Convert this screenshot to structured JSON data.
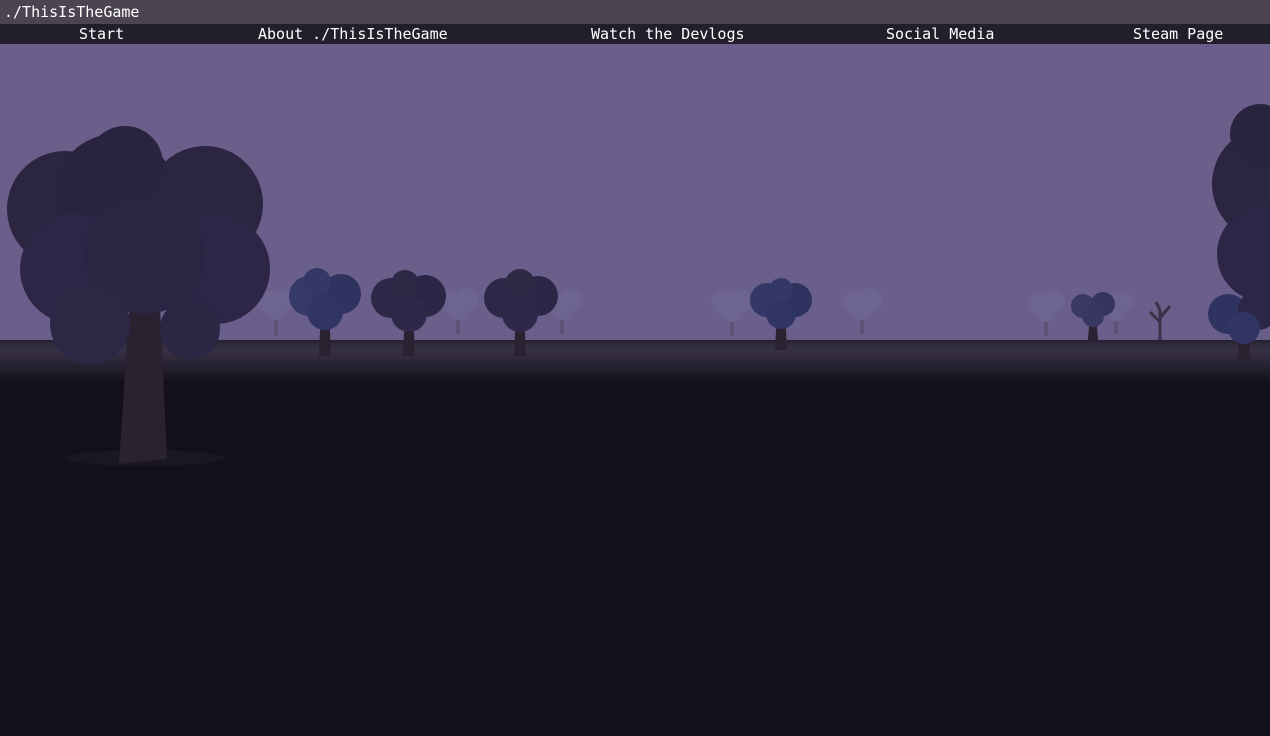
{
  "window": {
    "title": "./ThisIsTheGame"
  },
  "nav": {
    "items": [
      {
        "label": "Start"
      },
      {
        "label": "About ./ThisIsTheGame"
      },
      {
        "label": "Watch the Devlogs"
      },
      {
        "label": "Social Media"
      },
      {
        "label": "Steam Page"
      }
    ]
  },
  "colors": {
    "title_bar": "#4b4452",
    "nav_bar": "#221f2b",
    "sky": "#6a5f8a",
    "ground": "#121018",
    "foliage_near": "#2c2540",
    "foliage_mid": "#303055",
    "foliage_far": "#5e5578",
    "trunk": "#2a2230"
  },
  "scene": {
    "objects": [
      {
        "name": "large-tree-icon"
      },
      {
        "name": "tree-icon"
      },
      {
        "name": "tree-icon"
      },
      {
        "name": "tree-icon"
      },
      {
        "name": "tree-icon"
      },
      {
        "name": "tree-icon"
      },
      {
        "name": "distant-tree-icon"
      },
      {
        "name": "dead-tree-icon"
      },
      {
        "name": "edge-tree-icon"
      }
    ]
  }
}
